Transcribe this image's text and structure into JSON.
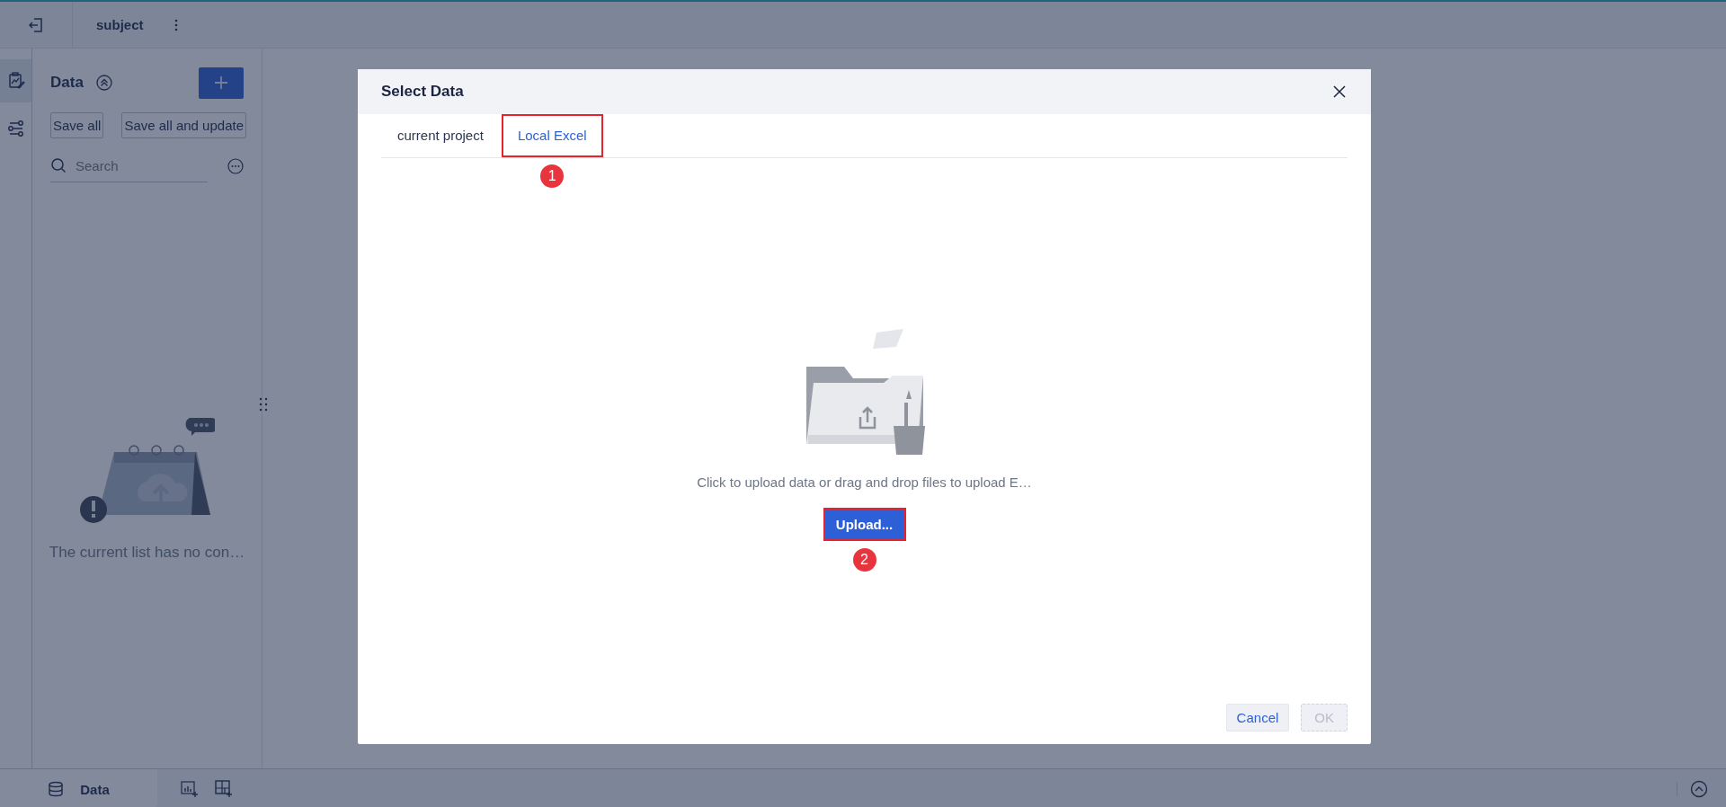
{
  "topbar": {
    "title": "subject"
  },
  "rail": [
    {
      "kind": "report",
      "selected": true
    },
    {
      "kind": "filter",
      "selected": false
    }
  ],
  "data_panel": {
    "title": "Data",
    "buttons": [
      "Save all",
      "Save all and update"
    ],
    "search": {
      "placeholder": "Search"
    },
    "empty_text": "The current list has no con…"
  },
  "bottom_bar": {
    "tabs": [
      {
        "label": "Data",
        "selected": true
      }
    ]
  },
  "dialog": {
    "title": "Select Data",
    "tabs": [
      {
        "label": "current project",
        "selected": false,
        "highlighted": false
      },
      {
        "label": "Local Excel",
        "selected": true,
        "highlighted": true,
        "callout": "1"
      }
    ],
    "hint": "Click to upload data or drag and drop files to upload E…",
    "upload": {
      "label": "Upload...",
      "highlighted": true,
      "callout": "2"
    },
    "buttons": [
      {
        "label": "Cancel",
        "disabled": false
      },
      {
        "label": "OK",
        "disabled": true
      }
    ]
  }
}
